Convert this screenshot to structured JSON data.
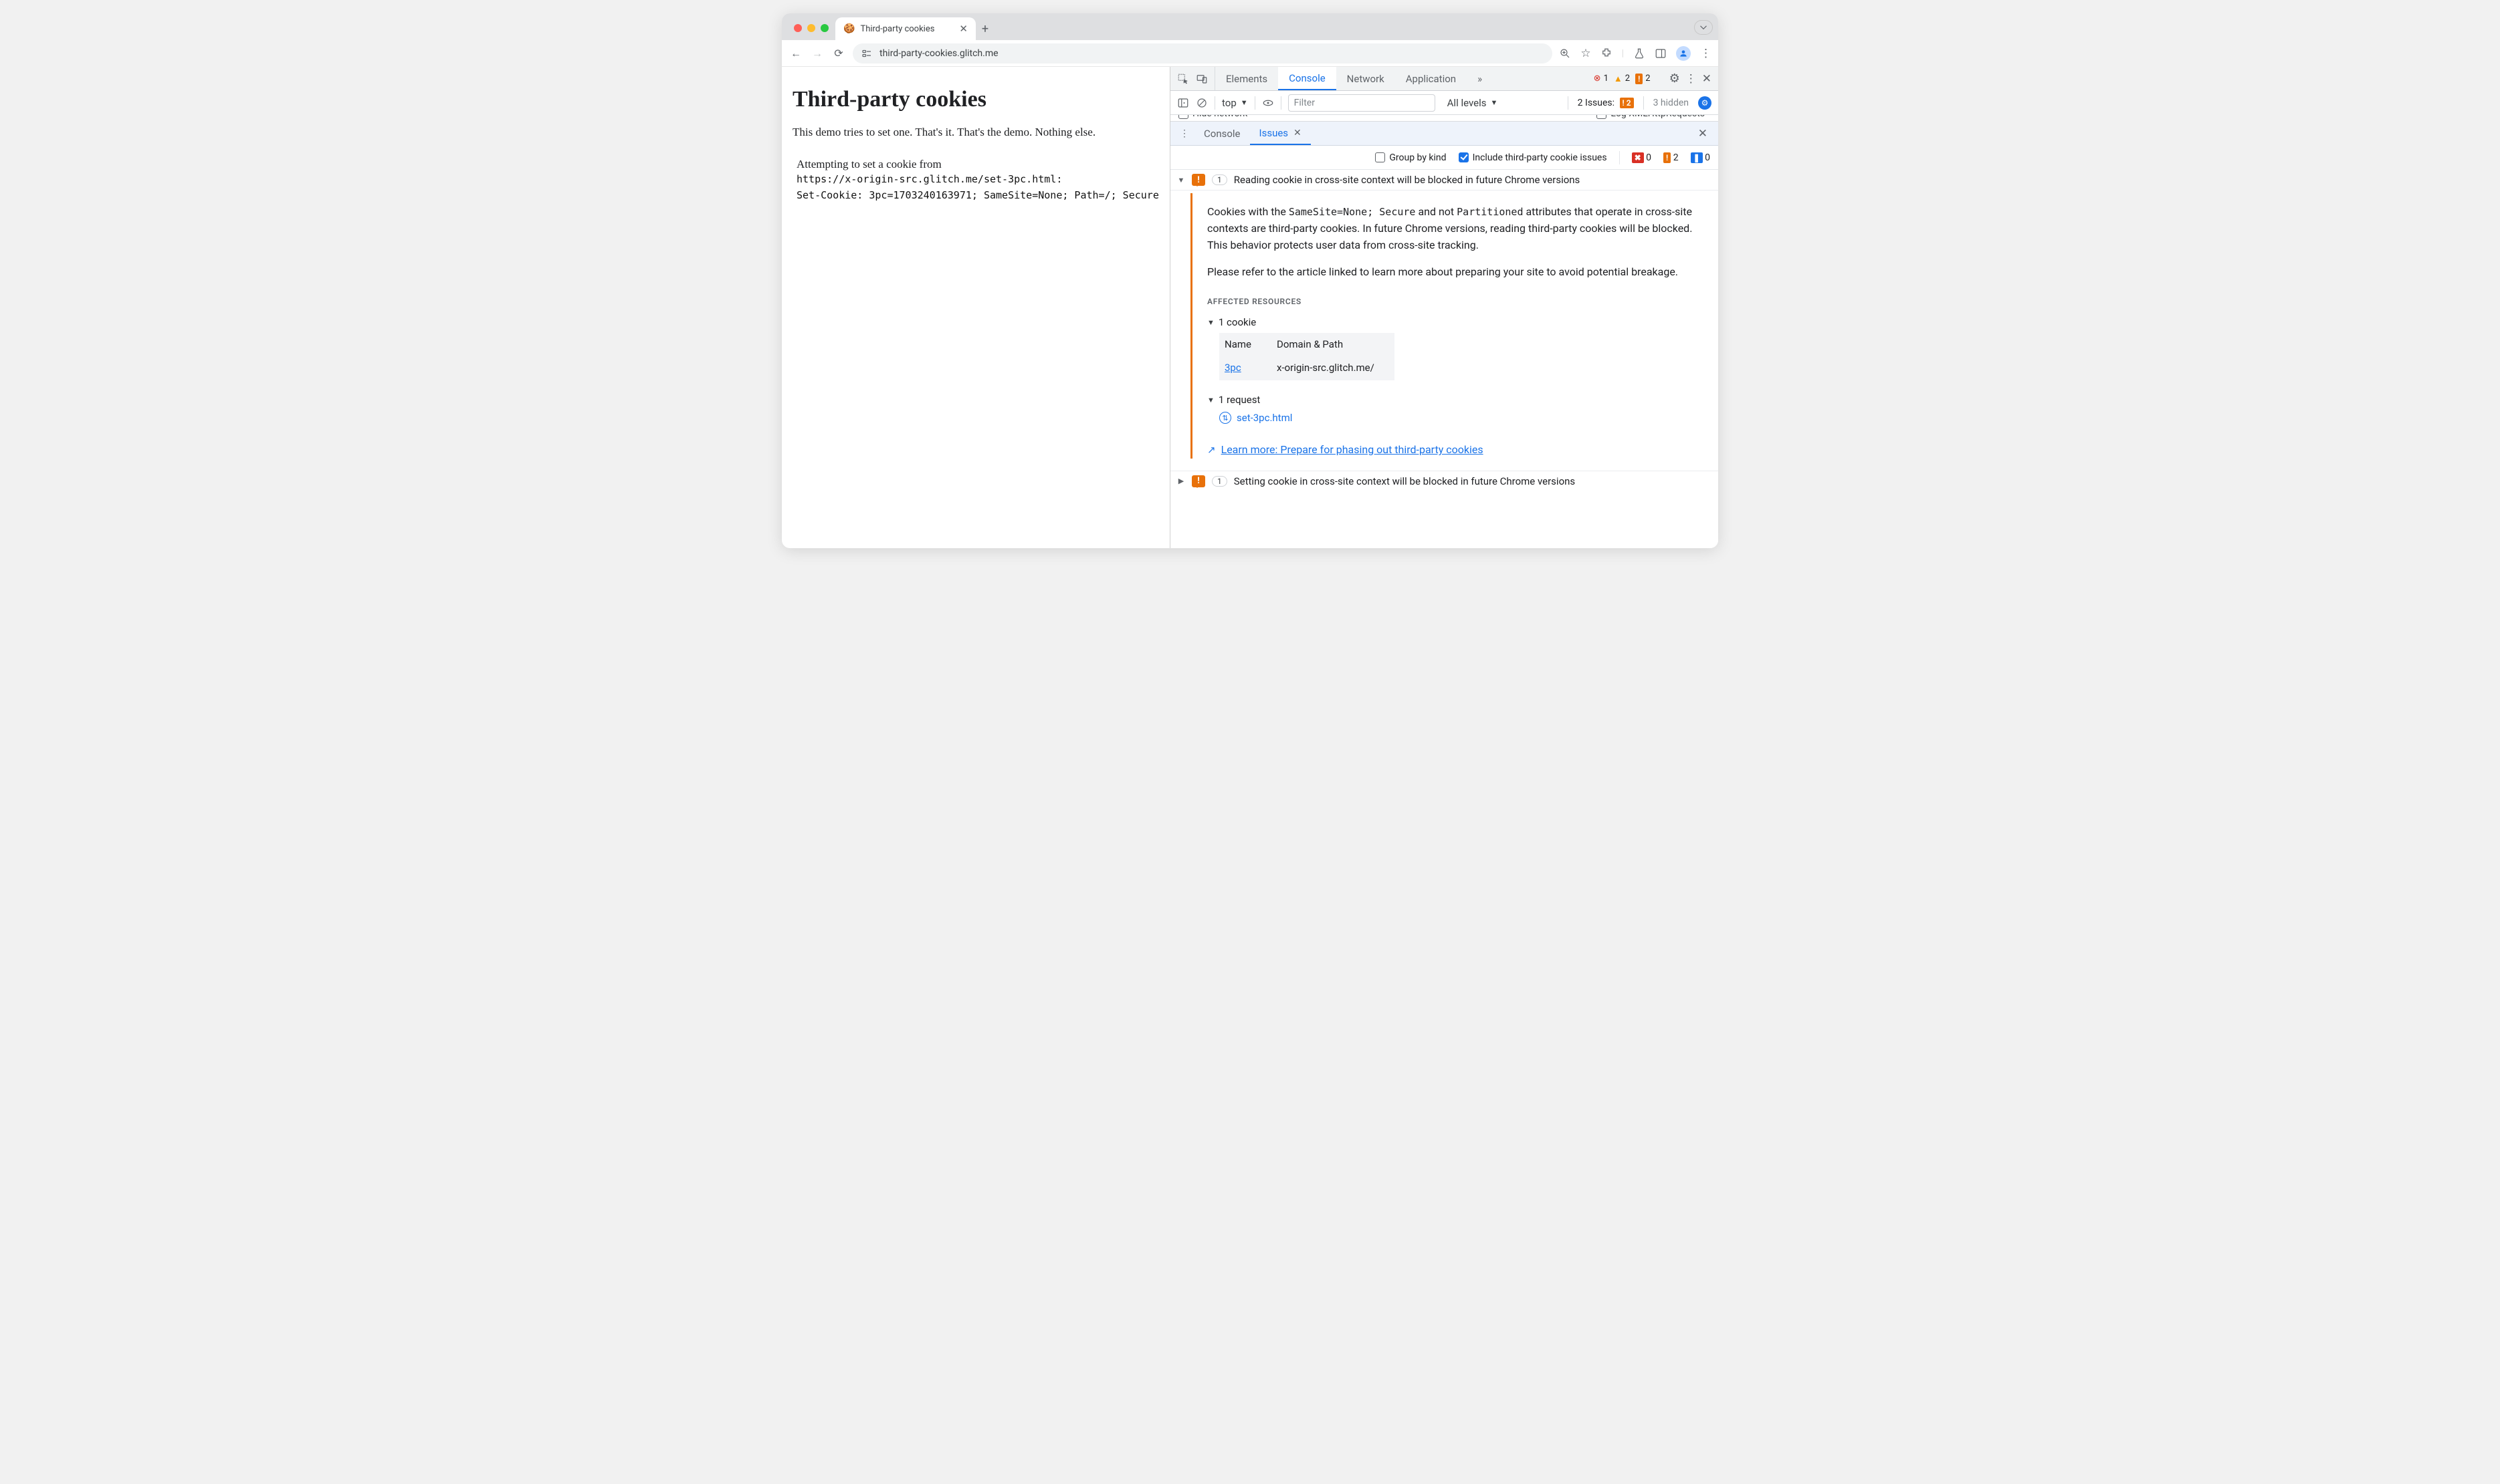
{
  "browser": {
    "tab_title": "Third-party cookies",
    "favicon": "🍪",
    "url": "third-party-cookies.glitch.me"
  },
  "page": {
    "h1": "Third-party cookies",
    "lead": "This demo tries to set one. That's it. That's the demo. Nothing else.",
    "attempt_line": "Attempting to set a cookie from",
    "attempt_url": "https://x-origin-src.glitch.me/set-3pc.html:",
    "set_cookie": "Set-Cookie: 3pc=1703240163971; SameSite=None; Path=/; Secure"
  },
  "devtools": {
    "tabs": {
      "elements": "Elements",
      "console": "Console",
      "network": "Network",
      "application": "Application"
    },
    "counts": {
      "errors": "1",
      "warnings": "2",
      "break": "2"
    },
    "subbar": {
      "context": "top",
      "filter_placeholder": "Filter",
      "levels": "All levels",
      "issues_label": "2 Issues:",
      "issues_break": "2",
      "hidden": "3 hidden"
    },
    "hidden_row": {
      "left": "Hide network",
      "right": "Log XMLHttpRequests"
    },
    "drawer": {
      "console": "Console",
      "issues": "Issues"
    },
    "issues_toolbar": {
      "group_by_kind": "Group by kind",
      "include_3p": "Include third-party cookie issues",
      "red": "0",
      "orange": "2",
      "blue": "0"
    },
    "issue1": {
      "count": "1",
      "title": "Reading cookie in cross-site context will be blocked in future Chrome versions",
      "para1_pre": "Cookies with the ",
      "code1": "SameSite=None; Secure",
      "para1_mid": " and not ",
      "code2": "Partitioned",
      "para1_post": " attributes that operate in cross-site contexts are third-party cookies. In future Chrome versions, reading third-party cookies will be blocked. This behavior protects user data from cross-site tracking.",
      "para2": "Please refer to the article linked to learn more about preparing your site to avoid potential breakage.",
      "affected_label": "AFFECTED RESOURCES",
      "cookie_count": "1 cookie",
      "th_name": "Name",
      "th_domain": "Domain & Path",
      "cookie_name": "3pc",
      "cookie_domain": "x-origin-src.glitch.me/",
      "request_count": "1 request",
      "request_file": "set-3pc.html",
      "learn_more": "Learn more: Prepare for phasing out third-party cookies"
    },
    "issue2": {
      "count": "1",
      "title": "Setting cookie in cross-site context will be blocked in future Chrome versions"
    }
  }
}
